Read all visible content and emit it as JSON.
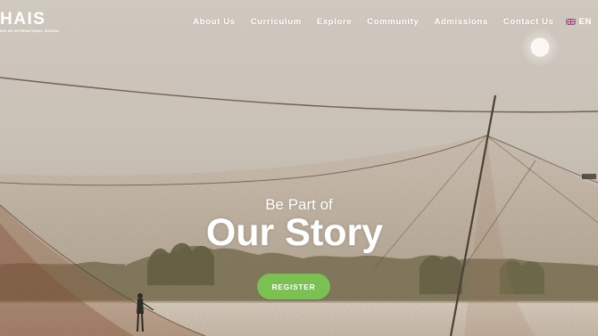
{
  "brand": {
    "logo_text": "HAIS",
    "logo_subtitle": "HOI AN INTERNATIONAL SCHOOL"
  },
  "nav": {
    "items": [
      {
        "label": "About Us"
      },
      {
        "label": "Curriculum"
      },
      {
        "label": "Explore"
      },
      {
        "label": "Community"
      },
      {
        "label": "Admissions"
      },
      {
        "label": "Contact Us"
      }
    ],
    "language": {
      "label": "EN",
      "flag_icon": "uk-flag-icon"
    }
  },
  "hero": {
    "pre_title": "Be Part of",
    "title": "Our Story",
    "cta_label": "REGISTER",
    "cta_color": "#7cbf52",
    "background_image": "fishing-net-river-sunset"
  }
}
